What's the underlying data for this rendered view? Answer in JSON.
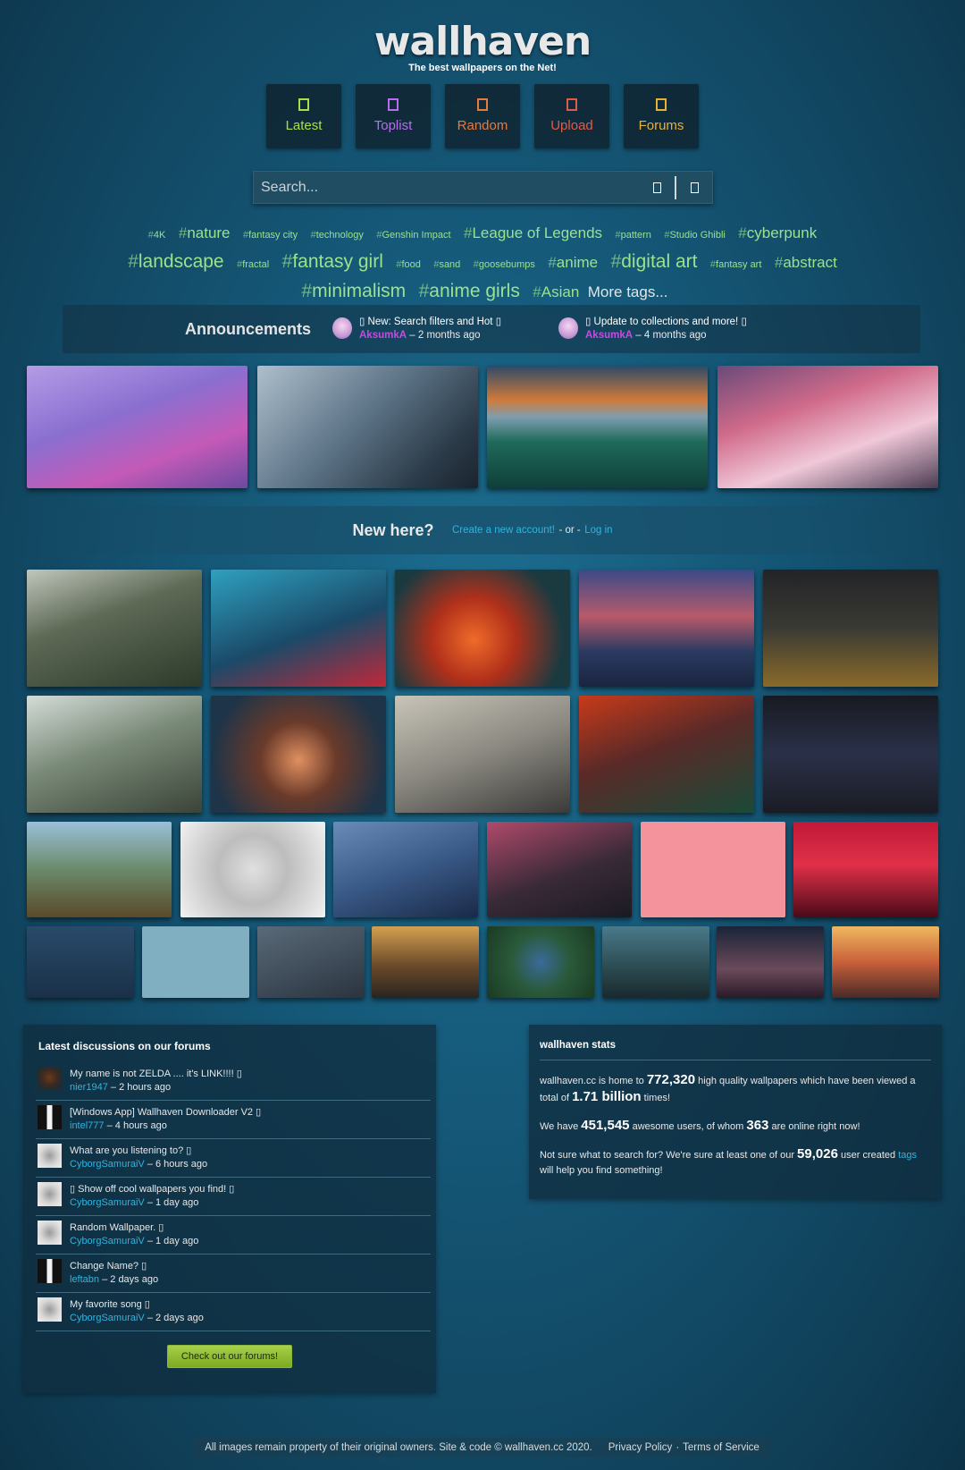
{
  "brand": {
    "logo": "wallhaven",
    "tagline": "The best wallpapers on the Net!"
  },
  "nav": [
    {
      "label": "Latest",
      "icon": "clock-icon",
      "color": "#a8e04a"
    },
    {
      "label": "Toplist",
      "icon": "star-icon",
      "color": "#b86cf0"
    },
    {
      "label": "Random",
      "icon": "random-icon",
      "color": "#e87a3c"
    },
    {
      "label": "Upload",
      "icon": "upload-icon",
      "color": "#e35a4a"
    },
    {
      "label": "Forums",
      "icon": "chat-icon",
      "color": "#e8b038"
    }
  ],
  "search": {
    "placeholder": "Search...",
    "value": ""
  },
  "tags": [
    {
      "t": "4K",
      "s": "s"
    },
    {
      "t": "nature",
      "s": "m"
    },
    {
      "t": "fantasy city",
      "s": "s"
    },
    {
      "t": "technology",
      "s": "s"
    },
    {
      "t": "Genshin Impact",
      "s": "s"
    },
    {
      "t": "League of Legends",
      "s": "m"
    },
    {
      "t": "pattern",
      "s": "s"
    },
    {
      "t": "Studio Ghibli",
      "s": "s"
    },
    {
      "t": "cyberpunk",
      "s": "m"
    },
    {
      "t": "landscape",
      "s": "l"
    },
    {
      "t": "fractal",
      "s": "s"
    },
    {
      "t": "fantasy girl",
      "s": "l"
    },
    {
      "t": "food",
      "s": "s"
    },
    {
      "t": "sand",
      "s": "s"
    },
    {
      "t": "goosebumps",
      "s": "s"
    },
    {
      "t": "anime",
      "s": "m"
    },
    {
      "t": "digital art",
      "s": "l"
    },
    {
      "t": "fantasy art",
      "s": "s"
    },
    {
      "t": "abstract",
      "s": "m"
    },
    {
      "t": "minimalism",
      "s": "l"
    },
    {
      "t": "anime girls",
      "s": "l"
    },
    {
      "t": "Asian",
      "s": "m"
    }
  ],
  "more_tags": "More tags...",
  "announcements": {
    "title": "Announcements",
    "items": [
      {
        "title": "▯ New: Search filters and Hot ▯",
        "user": "AksumkA",
        "time": "– 2 months ago"
      },
      {
        "title": "▯ Update to collections and more! ▯",
        "user": "AksumkA",
        "time": "– 4 months ago"
      }
    ]
  },
  "newhere": {
    "question": "New here?",
    "create": "Create a new account!",
    "or": "- or -",
    "login": "Log in"
  },
  "forums": {
    "title": "Latest discussions on our forums",
    "button": "Check out our forums!",
    "threads": [
      {
        "title": "My name is not ZELDA .... it's LINK!!!! ▯",
        "user": "nier1947",
        "time": "– 2 hours ago",
        "avatar": "spider"
      },
      {
        "title": "[Windows App] Wallhaven Downloader V2 ▯",
        "user": "intel777",
        "time": "– 4 hours ago",
        "avatar": "suit"
      },
      {
        "title": "What are you listening to? ▯",
        "user": "CyborgSamuraiV",
        "time": "– 6 hours ago",
        "avatar": "sketch"
      },
      {
        "title": "▯ Show off cool wallpapers you find! ▯",
        "user": "CyborgSamuraiV",
        "time": "– 1 day ago",
        "avatar": "sketch"
      },
      {
        "title": "Random Wallpaper. ▯",
        "user": "CyborgSamuraiV",
        "time": "– 1 day ago",
        "avatar": "sketch"
      },
      {
        "title": "Change Name? ▯",
        "user": "leftabn",
        "time": "– 2 days ago",
        "avatar": "suit"
      },
      {
        "title": "My favorite song ▯",
        "user": "CyborgSamuraiV",
        "time": "– 2 days ago",
        "avatar": "sketch"
      }
    ]
  },
  "stats": {
    "title": "wallhaven stats",
    "p1a": "wallhaven.cc is home to ",
    "wallpapers": "772,320",
    "p1b": " high quality wallpapers which have been viewed a total of ",
    "views": "1.71 billion",
    "p1c": " times!",
    "p2a": "We have ",
    "users": "451,545",
    "p2b": " awesome users, of whom ",
    "online": "363",
    "p2c": " are online right now!",
    "p3a": "Not sure what to search for? We're sure at least one of our ",
    "tagcount": "59,026",
    "p3b": " user created ",
    "tagslink": "tags",
    "p3c": " will help you find something!"
  },
  "footer": {
    "text": "All images remain property of their original owners. Site & code © wallhaven.cc 2020.",
    "privacy": "Privacy Policy",
    "dot": "·",
    "terms": "Terms of Service"
  }
}
